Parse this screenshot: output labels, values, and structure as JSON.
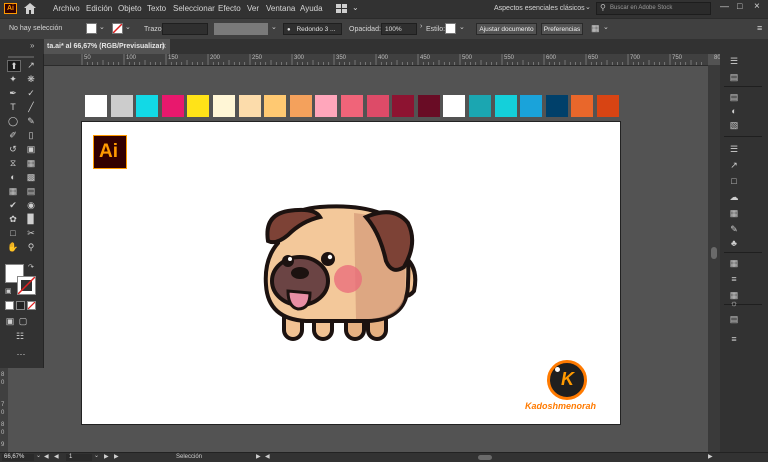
{
  "app": {
    "logo": "Ai",
    "menu": [
      "Archivo",
      "Edición",
      "Objeto",
      "Texto",
      "Seleccionar",
      "Efecto",
      "Ver",
      "Ventana",
      "Ayuda"
    ],
    "workspace": "Aspectos esenciales clásicos",
    "stock_search_placeholder": "Buscar en Adobe Stock"
  },
  "control_bar": {
    "selection_status": "No hay selección",
    "stroke_label": "Trazo:",
    "brush_value": "Redondo 3 ...",
    "opacity_label": "Opacidad:",
    "opacity_value": "100%",
    "style_label": "Estilo:",
    "adjust_document": "Ajustar documento",
    "preferences": "Preferencias"
  },
  "document_tab": {
    "title": "ta.ai* al 66,67% (RGB/Previsualizar)",
    "close": "×"
  },
  "ruler": {
    "top_labels": [
      "50",
      "100",
      "150",
      "200",
      "250",
      "300",
      "350",
      "400",
      "450",
      "500",
      "550",
      "600",
      "650",
      "700",
      "750",
      "800"
    ],
    "left_labels": [
      "8",
      "0",
      "7",
      "0",
      "8",
      "0",
      "9"
    ]
  },
  "swatches": [
    "#ffffff",
    "#cccccc",
    "#12d9e6",
    "#e8186d",
    "#ffe318",
    "#fff6d6",
    "#fcdcab",
    "#ffc972",
    "#f4a15c",
    "#ffa6bb",
    "#f06479",
    "#dd4b68",
    "#8d1331",
    "#690c25",
    "#ffffff",
    "#1ba6b1",
    "#14d0da",
    "#1aa3da",
    "#00406a",
    "#e9672b",
    "#d84413"
  ],
  "artboard": {
    "ai_logo": "Ai",
    "brand_letter": "K",
    "brand_name": "Kadoshmenorah"
  },
  "status_bar": {
    "zoom": "66,67%",
    "artboard_number": "1",
    "tool_name": "Selección"
  },
  "colors": {
    "ai_orange": "#ff9a00",
    "ai_dark": "#330000",
    "dog_face": "#f3c89a",
    "dog_ear": "#7d4236",
    "dog_blush": "#e9697a",
    "outline": "#1c1210"
  }
}
